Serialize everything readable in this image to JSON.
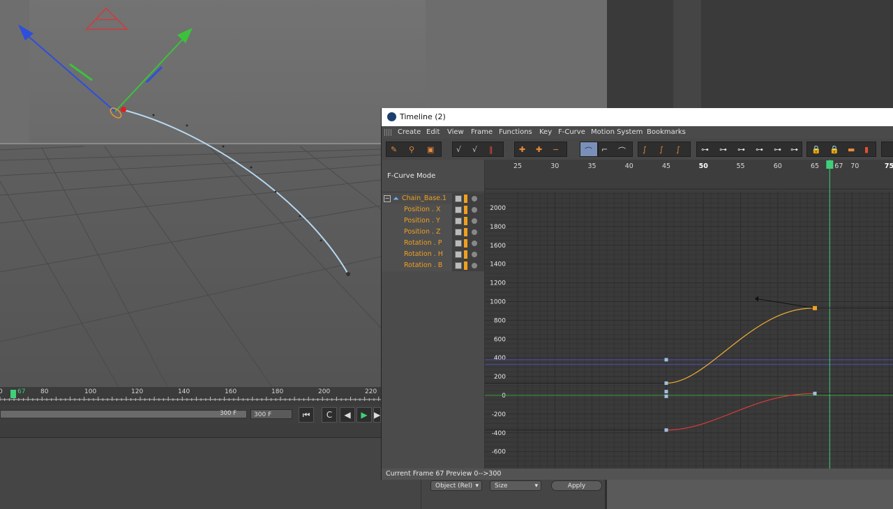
{
  "viewport": {
    "ruler_ticks": [
      "0",
      "67",
      "80",
      "100",
      "120",
      "140",
      "160",
      "180",
      "200",
      "220"
    ],
    "current_frame_label": "67",
    "end_field_1": "300 F",
    "end_field_2": "300 F"
  },
  "attributes": {
    "coord_dropdown": "Object (Rel)",
    "size_dropdown": "Size",
    "apply_button": "Apply"
  },
  "timeline": {
    "title": "Timeline (2)",
    "menu": [
      "Create",
      "Edit",
      "View",
      "Frame",
      "Functions",
      "Key",
      "F-Curve",
      "Motion System",
      "Bookmarks"
    ],
    "mode_label": "F-Curve Mode",
    "tree": [
      {
        "label": "Chain_Base.1",
        "root": true
      },
      {
        "label": "Position . X"
      },
      {
        "label": "Position . Y"
      },
      {
        "label": "Position . Z"
      },
      {
        "label": "Rotation . P"
      },
      {
        "label": "Rotation . H"
      },
      {
        "label": "Rotation . B"
      }
    ],
    "frame_labels": [
      "25",
      "30",
      "35",
      "40",
      "45",
      "50",
      "55",
      "60",
      "65",
      "67",
      "70",
      "75"
    ],
    "value_labels": [
      "2000",
      "1800",
      "1600",
      "1400",
      "1200",
      "1000",
      "800",
      "600",
      "400",
      "200",
      "0",
      "-200",
      "-400",
      "-600"
    ],
    "status": "Current Frame  67  Preview  0-->300"
  },
  "colors": {
    "playhead": "#3fd07a",
    "curve_orange": "#f0b030",
    "curve_red": "#e03a3a",
    "label_orange": "#f0a020",
    "key": "#9fc0e0"
  }
}
